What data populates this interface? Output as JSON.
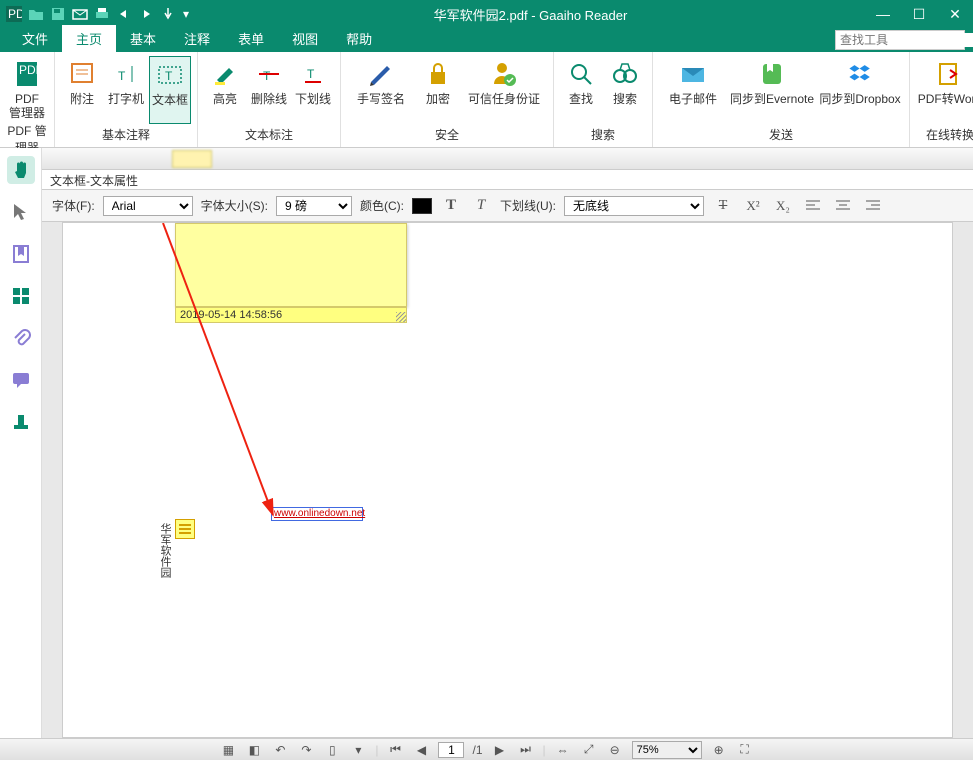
{
  "app": {
    "title": "华军软件园2.pdf - Gaaiho Reader"
  },
  "tabs": {
    "file": "文件",
    "home": "主页",
    "basic": "基本",
    "annot": "注释",
    "form": "表单",
    "view": "视图",
    "help": "帮助"
  },
  "search": {
    "placeholder": "查找工具"
  },
  "ribbon": {
    "pdfmgr": {
      "btn": "PDF\n管理器",
      "label": "PDF 管理器"
    },
    "annot_grp": {
      "attach": "附注",
      "type": "打字机",
      "textbox": "文本框",
      "label": "基本注释"
    },
    "markup_grp": {
      "highlight": "高亮",
      "strike": "删除线",
      "underline": "下划线",
      "label": "文本标注"
    },
    "security_grp": {
      "sign": "手写签名",
      "encrypt": "加密",
      "trust": "可信任身份证",
      "label": "安全"
    },
    "search_grp": {
      "find": "查找",
      "search": "搜索",
      "label": "搜索"
    },
    "send_grp": {
      "email": "电子邮件",
      "evernote": "同步到Evernote",
      "dropbox": "同步到Dropbox",
      "label": "发送"
    },
    "convert_grp": {
      "toword": "PDF转Word",
      "label": "在线转换"
    }
  },
  "propbar": {
    "title": "文本框-文本属性",
    "font_label": "字体(F):",
    "font_val": "Arial",
    "size_label": "字体大小(S):",
    "size_val": "9 磅",
    "color_label": "颜色(C):",
    "underline_label": "下划线(U):",
    "underline_val": "无底线"
  },
  "doc": {
    "note_timestamp": "2019-05-14 14:58:56",
    "vertical_text": "华军软件园",
    "textbox_text": "www.onlinedown.net"
  },
  "status": {
    "page_cur": "1",
    "page_sep": "/1",
    "zoom": "75%"
  }
}
